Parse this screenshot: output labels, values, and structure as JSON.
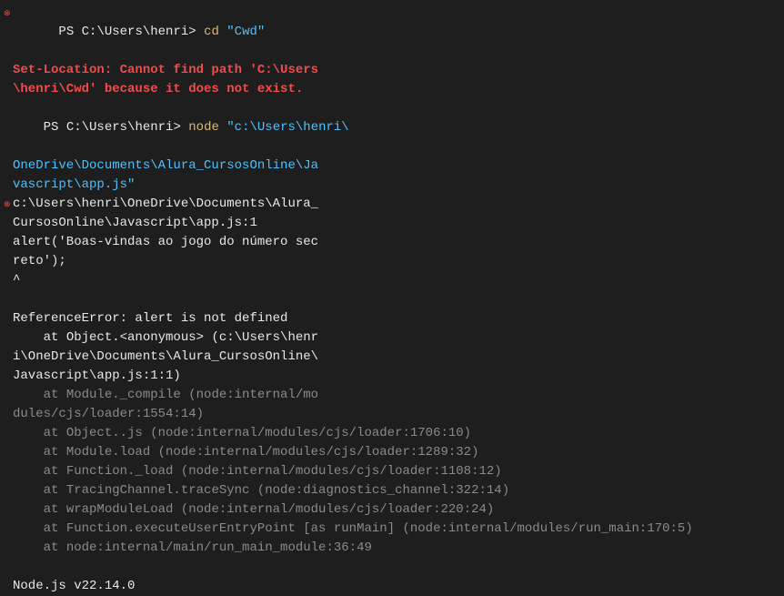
{
  "prompt1": {
    "ps": "PS ",
    "path": "C:\\Users\\henri>",
    "cmd": " cd ",
    "arg": "\"Cwd\""
  },
  "error1": {
    "l1": "Set-Location: Cannot find path 'C:\\Users",
    "l2": "\\henri\\Cwd' because it does not exist."
  },
  "prompt2": {
    "ps": "PS ",
    "path": "C:\\Users\\henri>",
    "cmd": " node ",
    "arg_l1": "\"c:\\Users\\henri\\",
    "arg_l2": "OneDrive\\Documents\\Alura_CursosOnline\\Ja",
    "arg_l3": "vascript\\app.js\""
  },
  "runtime_err": {
    "l1": "c:\\Users\\henri\\OneDrive\\Documents\\Alura_",
    "l2": "CursosOnline\\Javascript\\app.js:1",
    "l3": "alert('Boas-vindas ao jogo do número sec",
    "l4": "reto');",
    "l5": "^"
  },
  "ref_err": {
    "title": "ReferenceError: alert is not defined",
    "at1": "    at Object.<anonymous> (c:\\Users\\henr",
    "at1b": "i\\OneDrive\\Documents\\Alura_CursosOnline\\",
    "at1c": "Javascript\\app.js:1:1)",
    "dim1": "    at Module._compile (node:internal/mo",
    "dim1b": "dules/cjs/loader:1554:14)",
    "dim2": "    at Object..js (node:internal/modules/cjs/loader:1706:10)",
    "dim3": "    at Module.load (node:internal/modules/cjs/loader:1289:32)",
    "dim4": "    at Function._load (node:internal/modules/cjs/loader:1108:12)",
    "dim5": "    at TracingChannel.traceSync (node:diagnostics_channel:322:14)",
    "dim6": "    at wrapModuleLoad (node:internal/modules/cjs/loader:220:24)",
    "dim7": "    at Function.executeUserEntryPoint [as runMain] (node:internal/modules/run_main:170:5)",
    "dim8": "    at node:internal/main/run_main_module:36:49"
  },
  "node_version": "Node.js v22.14.0"
}
